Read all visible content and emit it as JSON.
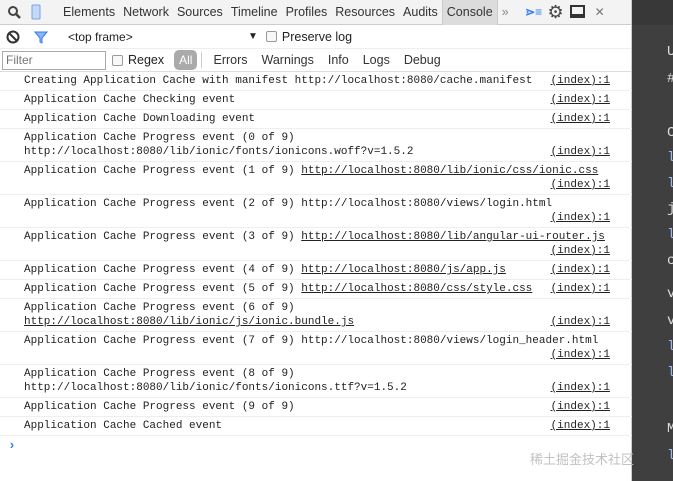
{
  "tabs": [
    "Elements",
    "Network",
    "Sources",
    "Timeline",
    "Profiles",
    "Resources",
    "Audits",
    "Console"
  ],
  "active_tab": "Console",
  "more": "»",
  "frame_select": "<top frame>",
  "preserve_log": "Preserve log",
  "filter_placeholder": "Filter",
  "regex": "Regex",
  "levels": [
    "All",
    "Errors",
    "Warnings",
    "Info",
    "Logs",
    "Debug"
  ],
  "messages": [
    {
      "text": "Creating Application Cache with manifest ",
      "url": "http://localhost:8080/cache.manifest",
      "url_link": false,
      "wrap": false,
      "src": "(index):1"
    },
    {
      "text": "Application Cache Checking event",
      "url": "",
      "wrap": false,
      "src": "(index):1"
    },
    {
      "text": "Application Cache Downloading event",
      "url": "",
      "wrap": false,
      "src": "(index):1"
    },
    {
      "text": "Application Cache Progress event (0 of 9)",
      "url": "http://localhost:8080/lib/ionic/fonts/ionicons.woff?v=1.5.2",
      "url_link": false,
      "url_newline": true,
      "wrap": true,
      "src": "(index):1"
    },
    {
      "text": "Application Cache Progress event (1 of 9) ",
      "url": "http://localhost:8080/lib/ionic/css/ionic.css",
      "url_link": true,
      "wrap": true,
      "src": "(index):1"
    },
    {
      "text": "Application Cache Progress event (2 of 9) ",
      "url": "http://localhost:8080/views/login.html",
      "url_link": false,
      "wrap": true,
      "src": "(index):1"
    },
    {
      "text": "Application Cache Progress event (3 of 9) ",
      "url": "http://localhost:8080/lib/angular-ui-router.js",
      "url_link": true,
      "wrap": true,
      "src": "(index):1"
    },
    {
      "text": "Application Cache Progress event (4 of 9) ",
      "url": "http://localhost:8080/js/app.js",
      "url_link": true,
      "wrap": false,
      "src": "(index):1"
    },
    {
      "text": "Application Cache Progress event (5 of 9) ",
      "url": "http://localhost:8080/css/style.css",
      "url_link": true,
      "wrap": false,
      "src": "(index):1"
    },
    {
      "text": "Application Cache Progress event (6 of 9)",
      "url": "http://localhost:8080/lib/ionic/js/ionic.bundle.js",
      "url_link": true,
      "url_newline": true,
      "wrap": true,
      "src": "(index):1"
    },
    {
      "text": "Application Cache Progress event (7 of 9) ",
      "url": "http://localhost:8080/views/login_header.html",
      "url_link": false,
      "wrap": true,
      "src": "(index):1"
    },
    {
      "text": "Application Cache Progress event (8 of 9)",
      "url": "http://localhost:8080/lib/ionic/fonts/ionicons.ttf?v=1.5.2",
      "url_link": false,
      "url_newline": true,
      "wrap": true,
      "src": "(index):1"
    },
    {
      "text": "Application Cache Progress event (9 of 9)",
      "url": "",
      "wrap": false,
      "src": "(index):1"
    },
    {
      "text": "Application Cache Cached event",
      "url": "",
      "wrap": false,
      "src": "(index):1"
    }
  ],
  "prompt": "›",
  "editor_chars": [
    "U",
    "#",
    "C",
    "l",
    "l",
    "j",
    "l",
    "c",
    "v",
    "v",
    "l",
    "l",
    "M",
    "l"
  ],
  "watermark": "稀土掘金技术社区"
}
